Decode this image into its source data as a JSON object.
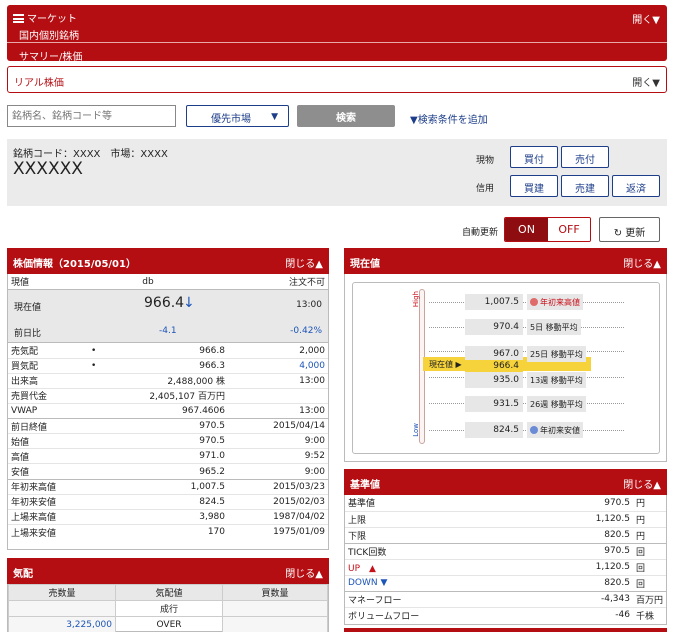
{
  "header": {
    "menu_label": "マーケット",
    "open_label": "開く▼",
    "breadcrumb_1": "国内個別銘柄",
    "breadcrumb_2": "サマリー/株価"
  },
  "realtime": {
    "title": "リアル株価",
    "open_label": "開く▼"
  },
  "search": {
    "placeholder": "銘柄名、銘柄コード等",
    "market_label": "優先市場",
    "market_arrow": "▼",
    "search_button": "検索",
    "add_condition": "▼検索条件を追加"
  },
  "stock": {
    "code_line": "銘柄コード：XXXX　市場：XXXX",
    "name": "XXXXXX",
    "cash_label": "現物",
    "margin_label": "信用",
    "buy": "買付",
    "sell": "売付",
    "margin_buy": "買建",
    "margin_sell": "売建",
    "repay": "返済"
  },
  "auto_update": {
    "label": "自動更新",
    "on": "ON",
    "off": "OFF",
    "refresh": "↻ 更新"
  },
  "quote_panel": {
    "title": "株価情報（2015/05/01）",
    "close_label": "閉じる▲",
    "head": {
      "left": "現値",
      "mid": "db",
      "right": "注文不可"
    },
    "current_label": "現在値",
    "current_value": "966.4",
    "current_arrow": "↓",
    "current_time": "13:00",
    "change_label": "前日比",
    "change_value": "-4.1",
    "change_pct": "-0.42%",
    "rows_a": [
      {
        "label": "売気配",
        "dot": "•",
        "value": "966.8",
        "right": "2,000",
        "blue": false
      },
      {
        "label": "買気配",
        "dot": "•",
        "value": "966.3",
        "right": "4,000",
        "blue": true
      },
      {
        "label": "出来高",
        "dot": "",
        "value": "2,488,000 株",
        "right": "13:00",
        "blue": false
      },
      {
        "label": "売買代金",
        "dot": "",
        "value": "2,405,107 百万円",
        "right": "",
        "blue": false
      },
      {
        "label": "VWAP",
        "dot": "",
        "value": "967.4606",
        "right": "13:00",
        "blue": false
      }
    ],
    "rows_b": [
      {
        "label": "前日終値",
        "value": "970.5",
        "right": "2015/04/14"
      },
      {
        "label": "始値",
        "value": "970.5",
        "right": "9:00"
      },
      {
        "label": "高値",
        "value": "971.0",
        "right": "9:52"
      },
      {
        "label": "安値",
        "value": "965.2",
        "right": "9:00"
      }
    ],
    "rows_c": [
      {
        "label": "年初来高値",
        "value": "1,007.5",
        "right": "2015/03/23"
      },
      {
        "label": "年初来安値",
        "value": "824.5",
        "right": "2015/02/03"
      },
      {
        "label": "上場来高値",
        "value": "3,980",
        "right": "1987/04/02"
      },
      {
        "label": "上場来安値",
        "value": "170",
        "right": "1975/01/09"
      }
    ]
  },
  "ita_panel": {
    "title": "気配",
    "close_label": "閉じる▲",
    "cols": [
      "売数量",
      "気配値",
      "買数量"
    ],
    "row1": {
      "sell": "",
      "price": "成行",
      "buy": ""
    },
    "row2": {
      "sell": "3,225,000",
      "price": "OVER",
      "buy": ""
    }
  },
  "price_panel": {
    "title": "現在値",
    "close_label": "閉じる▲",
    "high_label": "High",
    "low_label": "Low",
    "current_marker": "現在値 ▶",
    "levels": [
      {
        "value": "1,007.5",
        "desc": "年初来高値",
        "icon": "red"
      },
      {
        "value": "970.4",
        "desc": "5日 移動平均",
        "icon": ""
      },
      {
        "value": "967.0",
        "desc": "25日 移動平均",
        "icon": ""
      },
      {
        "value": "966.4",
        "desc": "",
        "icon": ""
      },
      {
        "value": "935.0",
        "desc": "13週 移動平均",
        "icon": ""
      },
      {
        "value": "931.5",
        "desc": "26週 移動平均",
        "icon": ""
      },
      {
        "value": "824.5",
        "desc": "年初来安値",
        "icon": "blue"
      }
    ]
  },
  "base_panel": {
    "title": "基準値",
    "close_label": "閉じる▲",
    "rows": [
      {
        "label": "基準値",
        "value": "970.5",
        "unit": "円",
        "cls": ""
      },
      {
        "label": "上限",
        "value": "1,120.5",
        "unit": "円",
        "cls": ""
      },
      {
        "label": "下限",
        "value": "820.5",
        "unit": "円",
        "cls": ""
      },
      {
        "label": "TICK回数",
        "value": "970.5",
        "unit": "回",
        "cls": ""
      },
      {
        "label": "UP　▲",
        "value": "1,120.5",
        "unit": "回",
        "cls": "red"
      },
      {
        "label": "DOWN ▼",
        "value": "820.5",
        "unit": "回",
        "cls": "blue"
      },
      {
        "label": "マネーフロー",
        "value": "-4,343",
        "unit": "百万円",
        "cls": ""
      },
      {
        "label": "ボリュームフロー",
        "value": "-46",
        "unit": "千株",
        "cls": ""
      }
    ]
  },
  "colors": {
    "brand_red": "#b40d12",
    "dark_red": "#8d0d10",
    "navy": "#1d3e8a",
    "blue": "#1d55b8"
  }
}
